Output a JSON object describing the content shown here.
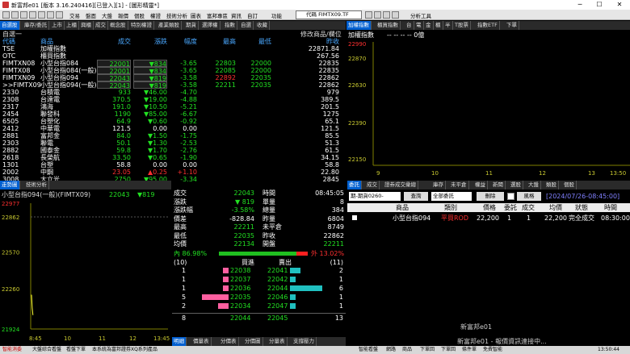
{
  "title": "新富邦e01 [版本 3.16.240416][已登入][1] - [圖形精靈*]",
  "winbtns": [
    "─",
    "☐",
    "✕"
  ],
  "menu": [
    "交易",
    "盤面",
    "大盤",
    "報價",
    "個股",
    "權證",
    "技術分析",
    "圖表",
    "富邦專區",
    "資訊",
    "自訂",
    "功能"
  ],
  "code_box": "代碼 FIMTX09.TF",
  "code_tool": "分析工具",
  "top_tabs": [
    "自選股",
    "庫存/委託",
    "上市",
    "上櫃",
    "興櫃",
    "成交",
    "概念股",
    "特別權證",
    "產業類股",
    "期貨",
    "選擇權",
    "指數",
    "自選",
    "收藏"
  ],
  "group_name": "自選一",
  "group_tail": "修改商品/欄位",
  "wl_headers": [
    "代碼",
    "商品",
    "成交",
    "漲跌",
    "幅度",
    "最高",
    "最低",
    "昨收"
  ],
  "wl_rows": [
    {
      "code": "TSE",
      "name": "加權指數",
      "last": "",
      "chg": "",
      "pct": "",
      "hi": "",
      "lo": "",
      "prev": "22871.84",
      "c": "wht"
    },
    {
      "code": "OTC",
      "name": "櫃買指數",
      "last": "",
      "chg": "",
      "pct": "",
      "hi": "",
      "lo": "",
      "prev": "267.56",
      "c": "wht"
    },
    {
      "code": "FIMTXN08",
      "name": "小型台指084",
      "last": "22001",
      "chg": "▼834",
      "pct": "-3.65",
      "hi": "22803",
      "lo": "22000",
      "prev": "22835",
      "c": "grn"
    },
    {
      "code": "FIMTX08",
      "name": "小型台指084(一般)",
      "last": "22001",
      "chg": "▼834",
      "pct": "-3.65",
      "hi": "22085",
      "lo": "22000",
      "prev": "22835",
      "c": "grn"
    },
    {
      "code": "FIMTXN09",
      "name": "小型台指094",
      "last": "22043",
      "chg": "▼819",
      "pct": "-3.58",
      "hi": "22892",
      "lo": "22035",
      "prev": "22862",
      "c": "grn"
    },
    {
      "code": ">>FIMTX09",
      "name": "小型台指094(一般)",
      "last": "22043",
      "chg": "▼819",
      "pct": "-3.58",
      "hi": "22211",
      "lo": "22035",
      "prev": "22862",
      "c": "grn"
    },
    {
      "code": "2330",
      "name": "台積電",
      "last": "933",
      "chg": "▼46.00",
      "pct": "-4.70",
      "hi": "",
      "lo": "",
      "prev": "979",
      "c": "grn"
    },
    {
      "code": "2308",
      "name": "台達電",
      "last": "370.5",
      "chg": "▼19.00",
      "pct": "-4.88",
      "hi": "",
      "lo": "",
      "prev": "389.5",
      "c": "grn"
    },
    {
      "code": "2317",
      "name": "鴻海",
      "last": "191.0",
      "chg": "▼10.50",
      "pct": "-5.21",
      "hi": "",
      "lo": "",
      "prev": "201.5",
      "c": "grn"
    },
    {
      "code": "2454",
      "name": "聯發科",
      "last": "1190",
      "chg": "▼85.00",
      "pct": "-6.67",
      "hi": "",
      "lo": "",
      "prev": "1275",
      "c": "grn"
    },
    {
      "code": "6505",
      "name": "台塑化",
      "last": "64.9",
      "chg": "▼0.60",
      "pct": "-0.92",
      "hi": "",
      "lo": "",
      "prev": "65.1",
      "c": "grn"
    },
    {
      "code": "2412",
      "name": "中華電",
      "last": "121.5",
      "chg": "0.00",
      "pct": "0.00",
      "hi": "",
      "lo": "",
      "prev": "121.5",
      "c": "wht"
    },
    {
      "code": "2881",
      "name": "富邦金",
      "last": "84.0",
      "chg": "▼1.50",
      "pct": "-1.75",
      "hi": "",
      "lo": "",
      "prev": "85.5",
      "c": "grn"
    },
    {
      "code": "2303",
      "name": "聯電",
      "last": "50.1",
      "chg": "▼1.30",
      "pct": "-2.53",
      "hi": "",
      "lo": "",
      "prev": "51.3",
      "c": "grn"
    },
    {
      "code": "2882",
      "name": "國泰金",
      "last": "59.8",
      "chg": "▼1.70",
      "pct": "-2.76",
      "hi": "",
      "lo": "",
      "prev": "61.5",
      "c": "grn"
    },
    {
      "code": "2618",
      "name": "長榮航",
      "last": "33.50",
      "chg": "▼0.65",
      "pct": "-1.90",
      "hi": "",
      "lo": "",
      "prev": "34.15",
      "c": "grn"
    },
    {
      "code": "1301",
      "name": "台塑",
      "last": "58.8",
      "chg": "0.00",
      "pct": "0.00",
      "hi": "",
      "lo": "",
      "prev": "58.8",
      "c": "wht"
    },
    {
      "code": "2002",
      "name": "中鋼",
      "last": "23.05",
      "chg": "▲0.25",
      "pct": "+1.10",
      "hi": "",
      "lo": "",
      "prev": "22.80",
      "c": "red"
    },
    {
      "code": "3008",
      "name": "大立光",
      "last": "2750",
      "chg": "▼95.00",
      "pct": "-3.34",
      "hi": "",
      "lo": "",
      "prev": "2845",
      "c": "grn"
    }
  ],
  "idx_tabs": [
    "加權指數",
    "櫃買指數",
    "台",
    "電",
    "金",
    "櫃",
    "半",
    "T股票",
    "指數ETF",
    "下單"
  ],
  "idx_title": "加權指數",
  "idx_values": "-- -- -- -- 0億",
  "idx_yticks": [
    "22990",
    "22870",
    "22630",
    "22390",
    "22150"
  ],
  "idx_xticks": [
    "9",
    "10",
    "11",
    "12",
    "13",
    "13:50"
  ],
  "chart_data": {
    "type": "line",
    "title": "小型台指094(一般)(FIMTX09)",
    "x_ticks": [
      "8:45",
      "10",
      "11",
      "12",
      "13:45"
    ],
    "y_ticks": [
      "22977",
      "22862",
      "22570",
      "22260",
      "21924"
    ],
    "ylim": [
      21924,
      22977
    ],
    "x": [
      "8:45",
      "8:47",
      "8:50",
      "8:55",
      "9:00",
      "9:30",
      "10:00",
      "11:00",
      "12:00",
      "13:00",
      "13:45"
    ],
    "values": [
      22211,
      22100,
      22040,
      null,
      null,
      null,
      null,
      null,
      null,
      null,
      null
    ],
    "prev_close": 22862,
    "color": "#ffff33"
  },
  "chart_tabs": [
    "走勢圖",
    "技術分析"
  ],
  "chart_last": "22043",
  "chart_chg": "▼819",
  "quote_left": [
    {
      "k": "成交",
      "v": "22043",
      "c": "grn"
    },
    {
      "k": "漲跌",
      "v": "▼ 819",
      "c": "grn"
    },
    {
      "k": "漲跌幅",
      "v": "-3.58%",
      "c": "grn"
    },
    {
      "k": "價差",
      "v": "-828.84",
      "c": "wht"
    },
    {
      "k": "最高",
      "v": "22211",
      "c": "grn"
    },
    {
      "k": "最低",
      "v": "22035",
      "c": "grn"
    },
    {
      "k": "均價",
      "v": "22134",
      "c": "grn"
    }
  ],
  "quote_right": [
    {
      "k": "時間",
      "v": "08:45:05",
      "c": "wht"
    },
    {
      "k": "單量",
      "v": "8",
      "c": "wht"
    },
    {
      "k": "總量",
      "v": "384",
      "c": "wht"
    },
    {
      "k": "昨量",
      "v": "6804",
      "c": "wht"
    },
    {
      "k": "未平倉",
      "v": "8749",
      "c": "wht"
    },
    {
      "k": "昨收",
      "v": "22862",
      "c": "wht"
    },
    {
      "k": "開盤",
      "v": "22211",
      "c": "grn"
    }
  ],
  "inner_label": "內 86.98%",
  "outer_label": "外 13.02%",
  "inner_pct": 86.98,
  "book_header": {
    "l": "(10)",
    "bid": "買進",
    "ask": "賣出",
    "r": "(11)"
  },
  "book": [
    {
      "bq": 1,
      "bid": "22038",
      "ask": "22041",
      "aq": 2
    },
    {
      "bq": 1,
      "bid": "22037",
      "ask": "22042",
      "aq": 1
    },
    {
      "bq": 1,
      "bid": "22036",
      "ask": "22044",
      "aq": 6
    },
    {
      "bq": 5,
      "bid": "22035",
      "ask": "22046",
      "aq": 1
    },
    {
      "bq": 2,
      "bid": "22034",
      "ask": "22047",
      "aq": 1
    }
  ],
  "book_total": {
    "bq": "8",
    "bid": "22044",
    "ask": "22045",
    "aq": "13"
  },
  "book_tabs": [
    "明細",
    "價量表",
    "分價表",
    "分價圖",
    "分量表",
    "支撐壓力"
  ],
  "order_tabs": [
    "委託",
    "成交",
    "證券成交彙總",
    "庫存",
    "未平倉",
    "權益",
    "新聞",
    "選股",
    "大盤",
    "類股",
    "個股"
  ],
  "order_filter": "期-期貨0260-",
  "order_btns": {
    "query": "查詢",
    "all": "全部委託",
    "del": "刪除",
    "risk": "風格"
  },
  "order_time": "[2024/07/26-08:45:00]",
  "order_headers": [
    "商品",
    "類別",
    "價格",
    "委託",
    "成交",
    "均價",
    "狀態",
    "時間"
  ],
  "order_row": {
    "item": "小型台指094",
    "kind": "平買ROD",
    "price": "22,200",
    "qty": "1",
    "done": "1",
    "avg": "22,200",
    "state": "完全成交",
    "time": "08:30:00"
  },
  "msg1": "新富邦e01",
  "msg2": "新富邦e01 - 報價資訊連接中...",
  "status": [
    "智能消委",
    "大盤綜合看盤",
    "看盤下單",
    "本系統為富邦證券XQ系列產品"
  ],
  "status_right": [
    "智能看盤",
    "網路",
    "商品",
    "下單回",
    "下單回",
    "條件單",
    "免費智能",
    "13:50:44"
  ]
}
